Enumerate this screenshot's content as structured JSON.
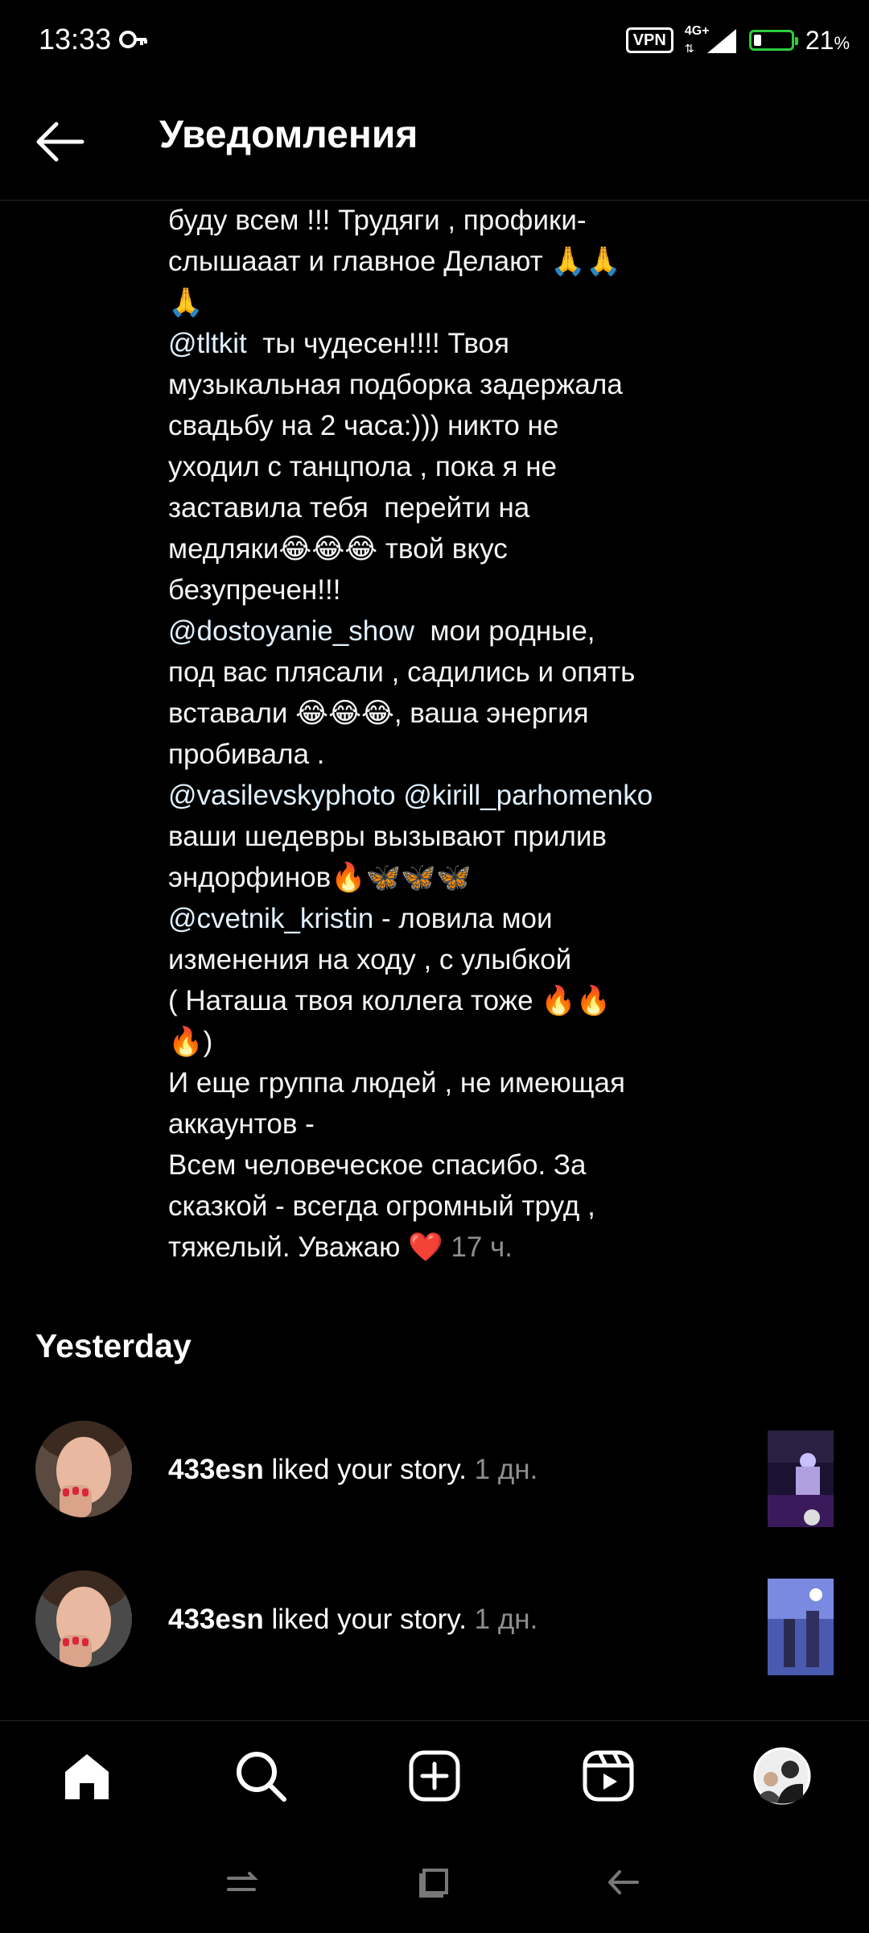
{
  "status_bar": {
    "time": "13:33",
    "vpn": "VPN",
    "network": "4G+",
    "battery_level": 21,
    "battery_label": "21",
    "battery_unit": "%",
    "colors": {
      "battery": "#2ecc40"
    }
  },
  "header": {
    "title": "Уведомления",
    "back_icon": "arrow-left-icon"
  },
  "comment": {
    "parts": [
      {
        "text": "буду всем !!! Трудяги , профики-\nслышааат и главное Делают 🙏🙏\n🙏\n"
      },
      {
        "text": "@tltkit",
        "mention": true
      },
      {
        "text": "  ты чудесен!!!! Твоя\nмузыкальная подборка задержала\nсвадьбу на 2 часа:))) никто не\nуходил с танцпола , пока я не\nзаставила тебя  перейти на\nмедляки😂😂😂 твой вкус\nбезупречен!!!\n"
      },
      {
        "text": "@dostoyanie_show",
        "mention": true
      },
      {
        "text": "  мои родные,\nпод вас плясали , садились и опять\nвставали 😂😂😂, ваша энергия\nпробивала .\n"
      },
      {
        "text": "@vasilevskyphoto",
        "mention": true
      },
      {
        "text": " "
      },
      {
        "text": "@kirill_parhomenko",
        "mention": true
      },
      {
        "text": "\nваши шедевры вызывают прилив\nэндорфинов🔥🦋🦋🦋\n"
      },
      {
        "text": "@cvetnik_kristin",
        "mention": true
      },
      {
        "text": " - ловила мои\nизменения на ходу , с улыбкой\n( Наташа твоя коллега тоже 🔥🔥\n🔥)\nИ еще группа людей , не имеющая\nаккаунтов -\nВсем человеческое спасибо. За\nсказкой - всегда огромный труд ,\nтяжелый. Уважаю ❤️ "
      },
      {
        "text": "17 ч.",
        "meta": true
      }
    ]
  },
  "section": {
    "title": "Yesterday"
  },
  "notifications": [
    {
      "username": "433esn",
      "action": " liked your story. ",
      "time": "1 дн."
    },
    {
      "username": "433esn",
      "action": " liked your story. ",
      "time": "1 дн."
    }
  ],
  "bottom_nav": [
    {
      "icon": "home-icon"
    },
    {
      "icon": "search-icon"
    },
    {
      "icon": "create-post-icon"
    },
    {
      "icon": "reels-icon"
    },
    {
      "icon": "profile-avatar"
    }
  ],
  "system_nav": [
    {
      "icon": "recents-icon"
    },
    {
      "icon": "home-square-icon"
    },
    {
      "icon": "back-icon"
    }
  ]
}
